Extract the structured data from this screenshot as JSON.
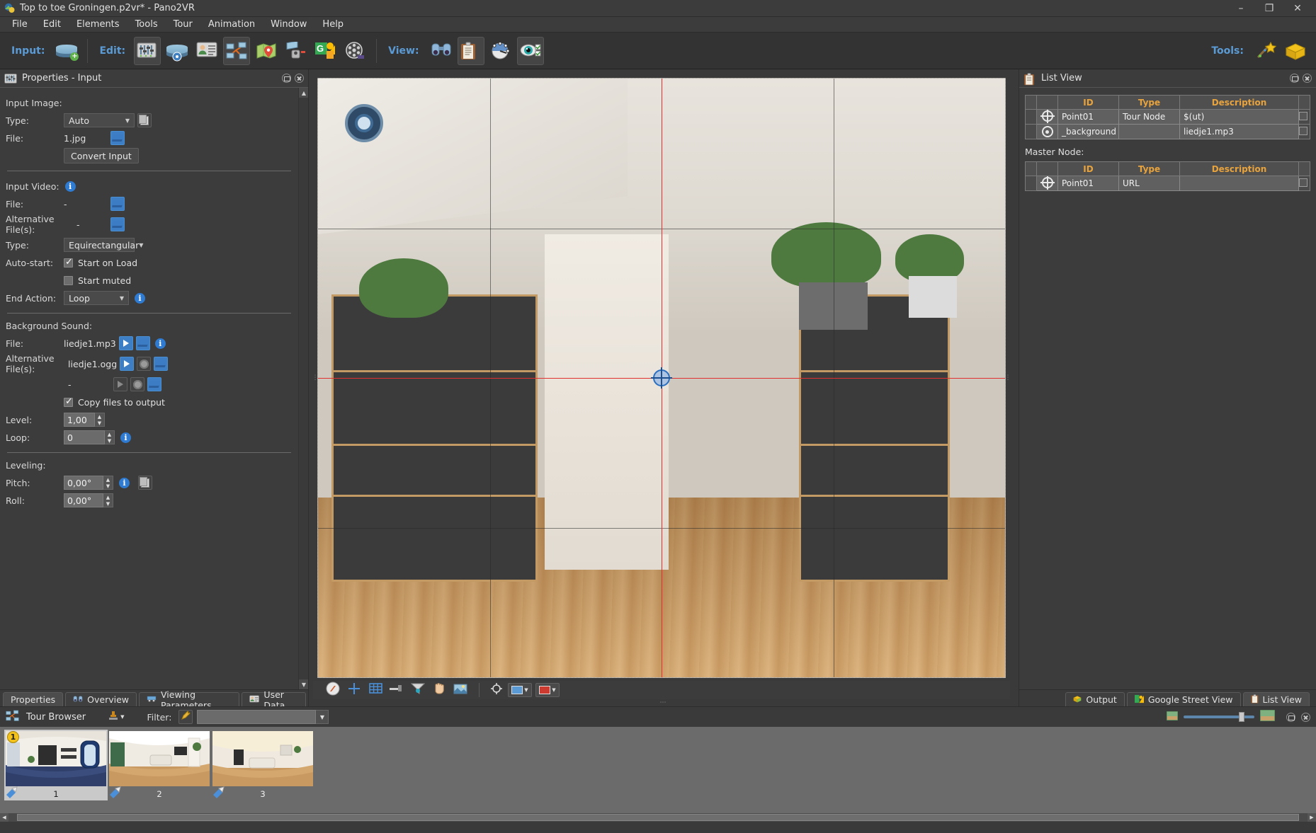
{
  "window": {
    "title": "Top to toe Groningen.p2vr* - Pano2VR",
    "app_icon": "pano2vr-logo-icon",
    "controls": {
      "minimize": "–",
      "maximize": "❐",
      "close": "✕"
    }
  },
  "menubar": [
    {
      "label": "File",
      "accel": "F"
    },
    {
      "label": "Edit",
      "accel": "E"
    },
    {
      "label": "Elements",
      "accel": "l"
    },
    {
      "label": "Tools",
      "accel": "T"
    },
    {
      "label": "Tour",
      "accel": "u"
    },
    {
      "label": "Animation",
      "accel": "A"
    },
    {
      "label": "Window",
      "accel": "W"
    },
    {
      "label": "Help",
      "accel": "H"
    }
  ],
  "toolbar": {
    "input_label": "Input:",
    "edit_label": "Edit:",
    "view_label": "View:",
    "tools_label": "Tools:",
    "input_buttons": [
      {
        "name": "add-input-panorama-button",
        "icon": "panorama-add-icon"
      }
    ],
    "edit_buttons": [
      {
        "name": "properties-button",
        "icon": "sliders-icon",
        "active": true
      },
      {
        "name": "patch-tool-button",
        "icon": "panorama-patch-icon",
        "active": false
      },
      {
        "name": "user-data-button",
        "icon": "user-card-icon",
        "active": false
      },
      {
        "name": "tour-browser-button",
        "icon": "tour-nodes-icon",
        "active": true
      },
      {
        "name": "map-button",
        "icon": "map-pin-icon",
        "active": false
      },
      {
        "name": "skin-editor-button",
        "icon": "skin-editor-icon",
        "active": false
      },
      {
        "name": "google-street-view-button",
        "icon": "google-street-view-icon",
        "active": false
      },
      {
        "name": "animation-button",
        "icon": "film-reel-icon",
        "active": false
      }
    ],
    "view_buttons": [
      {
        "name": "overview-button",
        "icon": "binoculars-icon",
        "active": false
      },
      {
        "name": "list-view-button",
        "icon": "clipboard-icon",
        "active": true
      },
      {
        "name": "viewing-parameters-button",
        "icon": "viewing-parameters-icon",
        "active": false
      },
      {
        "name": "preview-button",
        "icon": "eye-checklist-icon",
        "active": true
      }
    ],
    "tools_buttons": [
      {
        "name": "new-project-wizard-button",
        "icon": "wizard-star-icon"
      },
      {
        "name": "output-button",
        "icon": "output-package-icon"
      }
    ]
  },
  "properties_panel": {
    "header": {
      "title": "Properties - Input",
      "icon": "sliders-icon"
    },
    "input_image": {
      "section_label": "Input Image:",
      "type_label": "Type:",
      "type_value": "Auto",
      "copy_button": "copy-icon",
      "file_label": "File:",
      "file_value": "1.jpg",
      "open_button": "folder-icon",
      "convert_button": "Convert Input"
    },
    "input_video": {
      "section_label": "Input Video:",
      "info_icon": "info-icon",
      "file_label": "File:",
      "file_value": "-",
      "alt_files_label": "Alternative File(s):",
      "alt_files_value": "-",
      "type_label": "Type:",
      "type_value": "Equirectangular",
      "autostart_label": "Auto-start:",
      "start_on_load_label": "Start on Load",
      "start_on_load_checked": true,
      "start_muted_label": "Start muted",
      "start_muted_checked": false,
      "end_action_label": "End Action:",
      "end_action_value": "Loop"
    },
    "background_sound": {
      "section_label": "Background Sound:",
      "file_label": "File:",
      "file_value": "liedje1.mp3",
      "alt_files_label": "Alternative File(s):",
      "alt_file_1": "liedje1.ogg",
      "alt_file_2": "-",
      "copy_to_output_label": "Copy files to output",
      "copy_to_output_checked": true,
      "level_label": "Level:",
      "level_value": "1,00",
      "loop_label": "Loop:",
      "loop_value": "0"
    },
    "leveling": {
      "section_label": "Leveling:",
      "pitch_label": "Pitch:",
      "pitch_value": "0,00°",
      "roll_label": "Roll:",
      "roll_value": "0,00°"
    },
    "tabs": [
      {
        "label": "Properties",
        "icon": "properties-icon",
        "active": true
      },
      {
        "label": "Overview",
        "icon": "binoculars-icon",
        "active": false
      },
      {
        "label": "Viewing Parameters",
        "icon": "viewing-parameters-icon",
        "active": false
      },
      {
        "label": "User Data",
        "icon": "user-card-icon",
        "active": false
      }
    ]
  },
  "viewer": {
    "compass_badge": "compass-icon",
    "center_hotspot": "point-hotspot-icon",
    "toolbar_buttons": [
      {
        "name": "compass-tool-button",
        "icon": "compass-icon"
      },
      {
        "name": "crosshair-tool-button",
        "icon": "crosshair-icon"
      },
      {
        "name": "grid-tool-button",
        "icon": "grid-icon"
      },
      {
        "name": "horizon-tool-button",
        "icon": "horizon-icon"
      },
      {
        "name": "zenith-tool-button",
        "icon": "funnel-icon"
      },
      {
        "name": "pan-tool-button",
        "icon": "hand-icon"
      },
      {
        "name": "patch-tool-button",
        "icon": "patch-image-icon"
      },
      {
        "name": "hotspot-tool-button",
        "icon": "target-icon"
      }
    ],
    "fill_swatch_color": "#5b9bd5",
    "stroke_swatch_color": "#cc3a30"
  },
  "list_view": {
    "header": {
      "title": "List View",
      "icon": "clipboard-icon"
    },
    "columns": [
      "",
      "",
      "ID",
      "Type",
      "Description"
    ],
    "rows": [
      {
        "icon": "point-hotspot-icon",
        "id": "Point01",
        "type": "Tour Node",
        "description": "$(ut)"
      },
      {
        "icon": "sound-hotspot-icon",
        "id": "_background",
        "type": "",
        "description": "liedje1.mp3"
      }
    ],
    "master_node_label": "Master Node:",
    "master_columns": [
      "",
      "",
      "ID",
      "Type",
      "Description"
    ],
    "master_rows": [
      {
        "icon": "point-hotspot-icon",
        "id": "Point01",
        "type": "URL",
        "description": ""
      }
    ],
    "tabs": [
      {
        "label": "Output",
        "icon": "output-package-icon",
        "active": false
      },
      {
        "label": "Google Street View",
        "icon": "google-street-view-icon",
        "active": false
      },
      {
        "label": "List View",
        "icon": "clipboard-icon",
        "active": true
      }
    ]
  },
  "tour_browser": {
    "title": "Tour Browser",
    "icon": "tour-nodes-icon",
    "stamp_tool": "stamp-icon",
    "filter_label": "Filter:",
    "filter_icon": "tag-icon",
    "filter_value": "",
    "filter_placeholder": "",
    "zoom_small_icon": "thumbnail-small-icon",
    "zoom_large_icon": "thumbnail-large-icon",
    "nodes": [
      {
        "number": "1",
        "badge": "1",
        "selected": true
      },
      {
        "number": "2",
        "badge": "",
        "selected": false
      },
      {
        "number": "3",
        "badge": "",
        "selected": false
      }
    ]
  }
}
